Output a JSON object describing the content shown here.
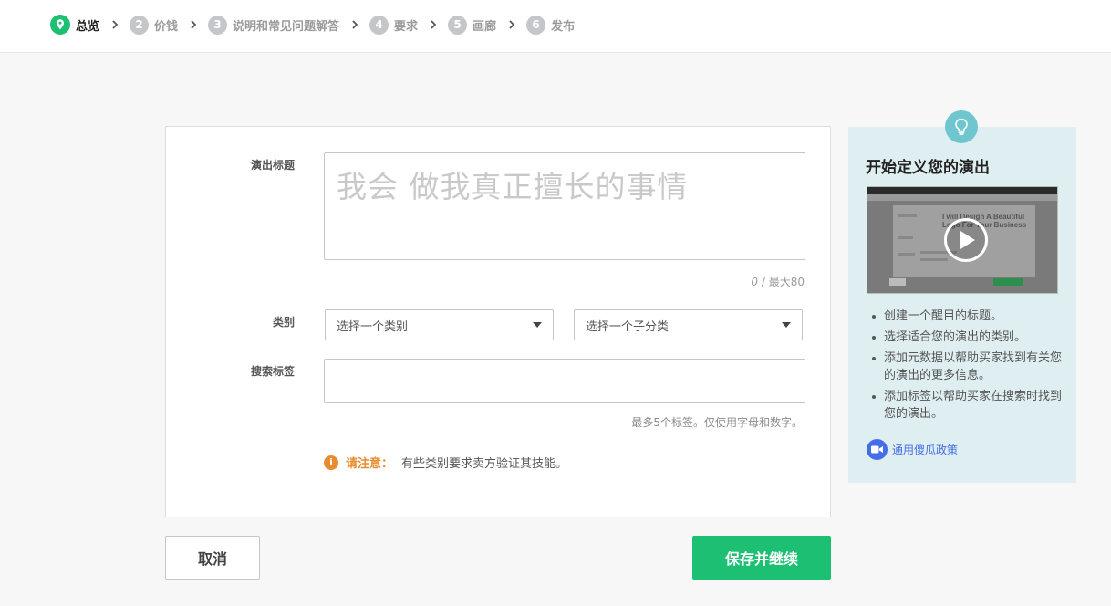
{
  "steps": [
    {
      "num": "",
      "label": "总览",
      "active": true
    },
    {
      "num": "2",
      "label": "价钱"
    },
    {
      "num": "3",
      "label": "说明和常见问题解答"
    },
    {
      "num": "4",
      "label": "要求"
    },
    {
      "num": "5",
      "label": "画廊"
    },
    {
      "num": "6",
      "label": "发布"
    }
  ],
  "form": {
    "title_label": "演出标题",
    "title_placeholder": "我会 做我真正擅长的事情",
    "char_count_current": "0",
    "char_count_max": " / 最大80",
    "category_label": "类别",
    "category_select": "选择一个类别",
    "subcategory_select": "选择一个子分类",
    "tags_label": "搜索标签",
    "tags_hint": "最多5个标签。仅使用字母和数字。",
    "notice_title": "请注意：",
    "notice_text": "有些类别要求卖方验证其技能。"
  },
  "buttons": {
    "cancel": "取消",
    "save": "保存并继续"
  },
  "side": {
    "title": "开始定义您的演出",
    "video_caption_1": "I will Design A Beautiful",
    "video_caption_2": "Logo For Your Business",
    "bullets": [
      "创建一个醒目的标题。",
      "选择适合您的演出的类别。",
      "添加元数据以帮助买家找到有关您的演出的更多信息。",
      "添加标签以帮助买家在搜索时找到您的演出。"
    ],
    "policy_link": "通用傻瓜政策"
  },
  "colors": {
    "accent_green": "#1dbf73",
    "warning_orange": "#e88b2e",
    "side_bg": "#dfeef1",
    "bulb_teal": "#6fc6cf",
    "link_blue": "#446ee7"
  }
}
